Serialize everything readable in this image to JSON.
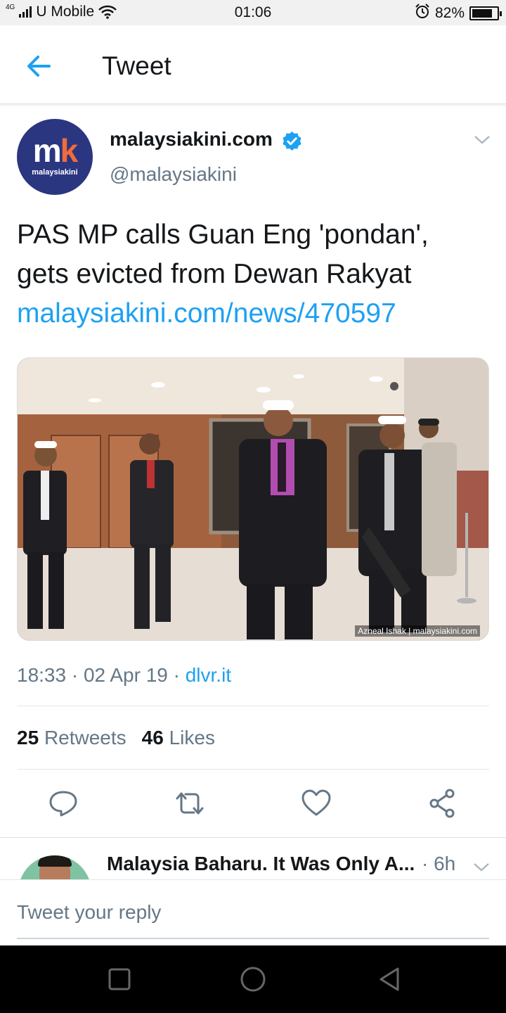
{
  "status_bar": {
    "network": "4G",
    "carrier": "U Mobile",
    "time": "01:06",
    "battery": "82%",
    "battery_level": 0.82
  },
  "header": {
    "title": "Tweet",
    "back_icon": "arrow-left-icon"
  },
  "tweet": {
    "avatar": {
      "mark": "m",
      "mark_accent": "k",
      "sub": "malaysiakini"
    },
    "name": "malaysiakini.com",
    "handle": "@malaysiakini",
    "verified": true,
    "text_line1": "PAS MP calls Guan Eng 'pondan',",
    "text_line2": "gets evicted from Dewan Rakyat",
    "link": "malaysiakini.com/news/470597",
    "media_credit": "Azneal Ishak | malaysiakini.com",
    "time": "18:33",
    "date": "02 Apr 19",
    "source": "dlvr.it",
    "retweets_count": "25",
    "retweets_label": "Retweets",
    "likes_count": "46",
    "likes_label": "Likes"
  },
  "actions": [
    "reply-icon",
    "retweet-icon",
    "like-icon",
    "share-icon"
  ],
  "reply_preview": {
    "name": "Malaysia Baharu. It Was Only A...",
    "time": "· 6h"
  },
  "compose": {
    "placeholder": "Tweet your reply"
  },
  "colors": {
    "accent": "#1da1f2",
    "text": "#14171a",
    "secondary": "#657786",
    "avatar_bg": "#2b3680",
    "avatar_accent": "#f26b3a"
  }
}
